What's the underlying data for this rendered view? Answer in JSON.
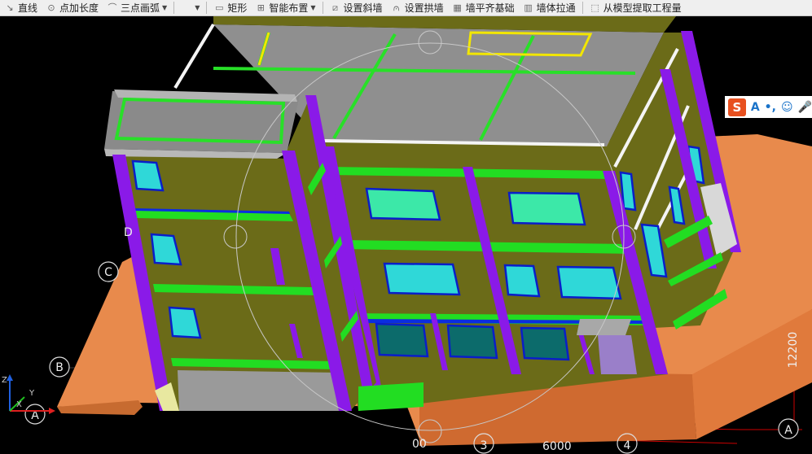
{
  "toolbar": {
    "items": [
      {
        "label": "直线",
        "icon": "line-icon"
      },
      {
        "label": "点加长度",
        "icon": "point-length-icon"
      },
      {
        "label": "三点画弧",
        "icon": "arc-icon",
        "dropdown": true
      },
      {
        "label": "",
        "icon": "dropdown-icon",
        "dropdown": true
      },
      {
        "label": "矩形",
        "icon": "rectangle-icon"
      },
      {
        "label": "智能布置",
        "icon": "smart-layout-icon",
        "dropdown": true
      },
      {
        "label": "设置斜墙",
        "icon": "slope-wall-icon"
      },
      {
        "label": "设置拱墙",
        "icon": "arch-wall-icon"
      },
      {
        "label": "墙平齐基础",
        "icon": "wall-flush-icon"
      },
      {
        "label": "墙体拉通",
        "icon": "wall-extend-icon"
      },
      {
        "label": "从模型提取工程量",
        "icon": "extract-quantity-icon"
      }
    ]
  },
  "axes": {
    "bubbles": [
      "C",
      "B",
      "A",
      "A"
    ],
    "partial_bubble": "D",
    "bottom_labels": [
      "00",
      "3",
      "6000",
      "4"
    ],
    "dimension_right": "12200"
  },
  "ucs": {
    "x_label": "X",
    "y_label": "Y",
    "z_label": "Z"
  },
  "ime": {
    "logo": "S",
    "mode": "A",
    "items": [
      "•,",
      "☺",
      "🎤"
    ]
  }
}
